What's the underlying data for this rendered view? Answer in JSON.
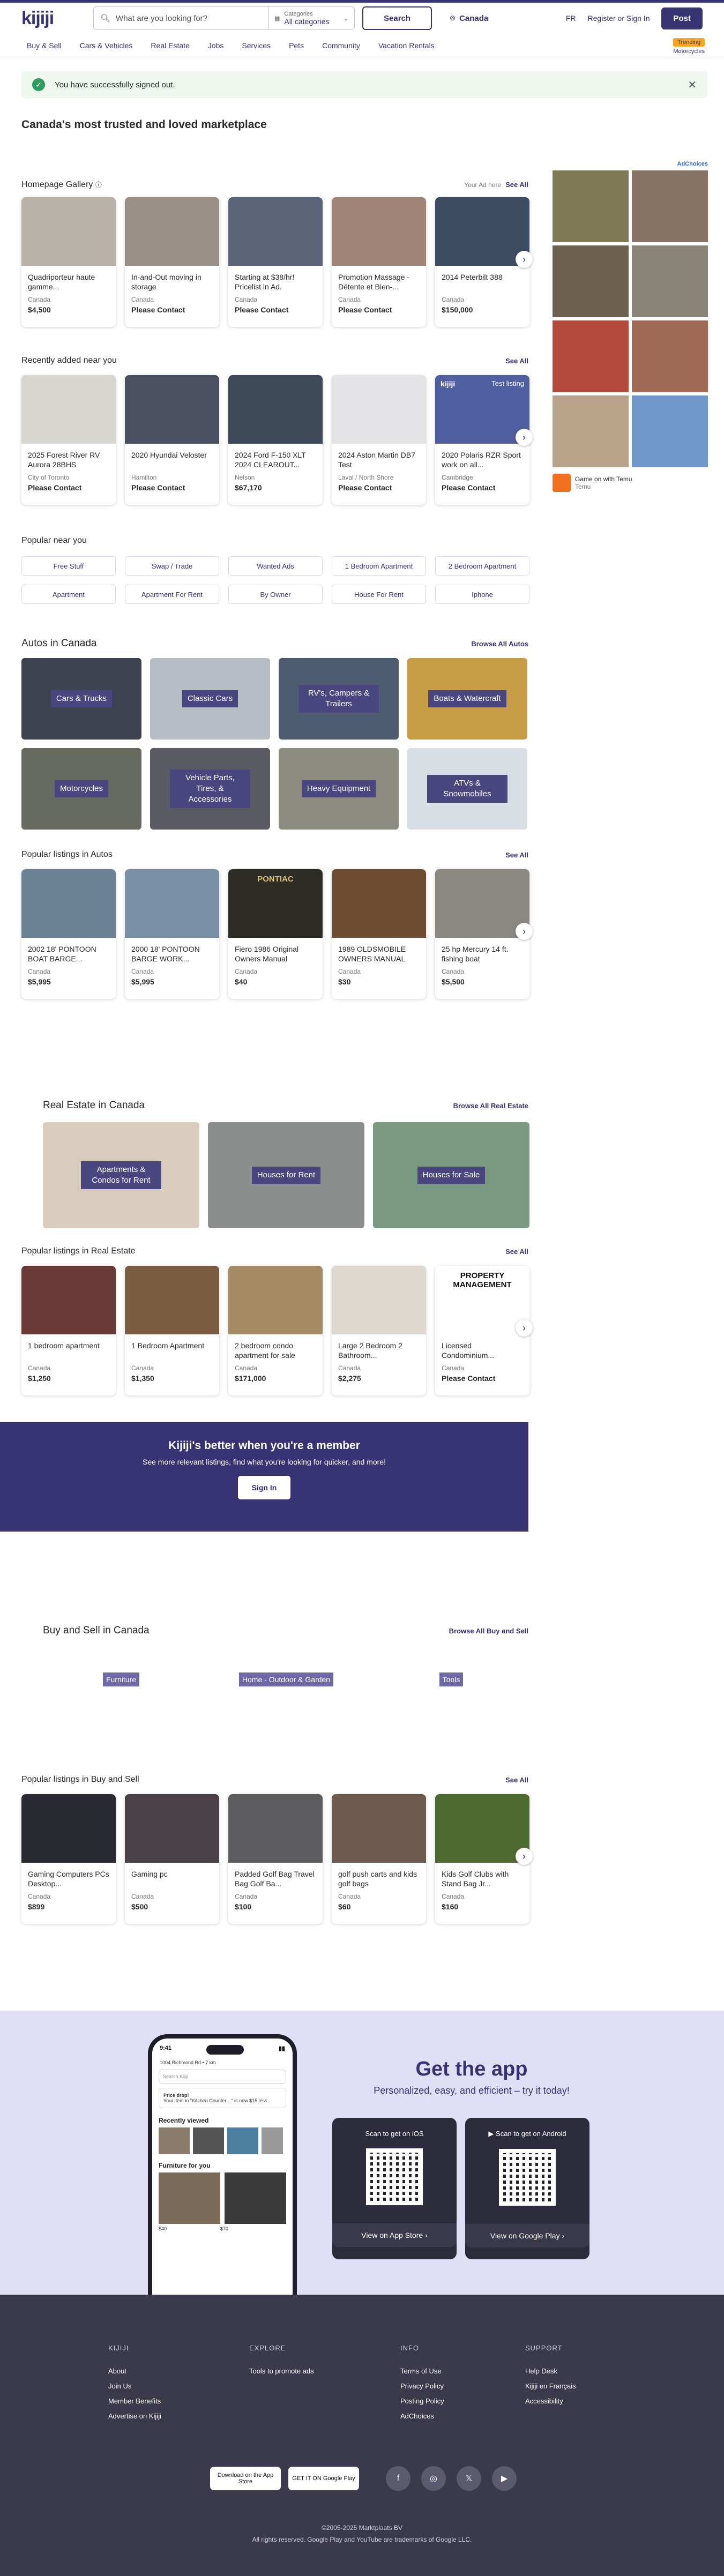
{
  "header": {
    "logo": "kijiji",
    "search_placeholder": "What are you looking for?",
    "categories_label": "Categories",
    "categories_value": "All categories",
    "search_button": "Search",
    "location": "Canada",
    "lang": "FR",
    "register": "Register or Sign In",
    "post": "Post"
  },
  "nav": {
    "items": [
      "Buy & Sell",
      "Cars & Vehicles",
      "Real Estate",
      "Jobs",
      "Services",
      "Pets",
      "Community",
      "Vacation Rentals"
    ],
    "trending_badge": "Trending",
    "trending_label": "Motorcycles"
  },
  "alert": {
    "text": "You have successfully signed out."
  },
  "page_title": "Canada's most trusted and loved marketplace",
  "gallery": {
    "title": "Homepage Gallery",
    "your_ad": "Your Ad here",
    "see_all": "See All",
    "items": [
      {
        "title": "Quadriporteur haute gamme...",
        "loc": "Canada",
        "price": "$4,500",
        "color": "#b8b2a8"
      },
      {
        "title": "In-and-Out moving in storage",
        "loc": "Canada",
        "price": "Please Contact",
        "color": "#9a8f86"
      },
      {
        "title": "Starting at $38/hr! Pricelist in Ad.",
        "loc": "Canada",
        "price": "Please Contact",
        "color": "#5b6478"
      },
      {
        "title": "Promotion Massage - Détente et Bien-...",
        "loc": "Canada",
        "price": "Please Contact",
        "color": "#a08476"
      },
      {
        "title": "2014 Peterbilt 388",
        "loc": "Canada",
        "price": "$150,000",
        "color": "#3c4c63"
      }
    ]
  },
  "recent": {
    "title": "Recently added near you",
    "see_all": "See All",
    "items": [
      {
        "title": "2025 Forest River RV Aurora 28BHS",
        "loc": "City of Toronto",
        "price": "Please Contact",
        "color": "#d7d5d0"
      },
      {
        "title": "2020 Hyundai Veloster",
        "loc": "Hamilton",
        "price": "Please Contact",
        "color": "#4b5060"
      },
      {
        "title": "2024 Ford F-150 XLT 2024 CLEAROUT...",
        "loc": "Nelson",
        "price": "$67,170",
        "color": "#3e4a5a"
      },
      {
        "title": "2024 Aston Martin DB7 Test",
        "loc": "Laval / North Shore",
        "price": "Please Contact",
        "color": "#e3e3e6"
      },
      {
        "title": "2020 Polaris RZR Sport work on all...",
        "loc": "Cambridge",
        "price": "Please Contact",
        "color": "#4f5fa0",
        "tag": "Test listing",
        "brand": "kijiji"
      }
    ]
  },
  "ad": {
    "choices": "AdChoices",
    "brand": "Game on with Temu",
    "sub": "Temu",
    "tiles": [
      "#7d7a55",
      "#887365",
      "#6d6150",
      "#8a8478",
      "#b34a3c",
      "#a16a57",
      "#b9a28a",
      "#6f97c9"
    ]
  },
  "popular": {
    "title": "Popular near you",
    "items": [
      "Free Stuff",
      "Swap / Trade",
      "Wanted Ads",
      "1 Bedroom Apartment",
      "2 Bedroom Apartment",
      "Apartment",
      "Apartment For Rent",
      "By Owner",
      "House For Rent",
      "Iphone"
    ]
  },
  "autos": {
    "title": "Autos in Canada",
    "link": "Browse All Autos",
    "tiles": [
      {
        "label": "Cars & Trucks",
        "color": "#3d4150"
      },
      {
        "label": "Classic Cars",
        "color": "#b8bcc4"
      },
      {
        "label": "RV's, Campers & Trailers",
        "color": "#4e5c72"
      },
      {
        "label": "Boats & Watercraft",
        "color": "#c89b46"
      },
      {
        "label": "Motorcycles",
        "color": "#666a60"
      },
      {
        "label": "Vehicle Parts, Tires, & Accessories",
        "color": "#5a5b63"
      },
      {
        "label": "Heavy Equipment",
        "color": "#8c8b80"
      },
      {
        "label": "ATVs & Snowmobiles",
        "color": "#d9dde4"
      }
    ]
  },
  "autos_listings": {
    "title": "Popular listings in Autos",
    "see_all": "See All",
    "items": [
      {
        "title": "2002 18' PONTOON BOAT BARGE...",
        "loc": "Canada",
        "price": "$5,995",
        "color": "#6b8196"
      },
      {
        "title": "2000 18' PONTOON BARGE WORK...",
        "loc": "Canada",
        "price": "$5,995",
        "color": "#7990a6"
      },
      {
        "title": "Fiero 1986 Original Owners Manual",
        "loc": "Canada",
        "price": "$40",
        "color": "#2e2c27",
        "label": "PONTIAC"
      },
      {
        "title": "1989 OLDSMOBILE OWNERS MANUAL",
        "loc": "Canada",
        "price": "$30",
        "color": "#6c4d33"
      },
      {
        "title": "25 hp Mercury 14 ft. fishing boat",
        "loc": "Canada",
        "price": "$5,500",
        "color": "#8a8880"
      }
    ]
  },
  "realestate": {
    "title": "Real Estate in Canada",
    "link": "Browse All Real Estate",
    "tiles": [
      {
        "label": "Apartments & Condos for Rent",
        "color": "#d8cdbd"
      },
      {
        "label": "Houses for Rent",
        "color": "#8c8d8d"
      },
      {
        "label": "Houses for Sale",
        "color": "#7b9a82"
      }
    ]
  },
  "re_listings": {
    "title": "Popular listings in Real Estate",
    "see_all": "See All",
    "items": [
      {
        "title": "1 bedroom apartment",
        "loc": "Canada",
        "price": "$1,250",
        "color": "#6a3a36"
      },
      {
        "title": "1 Bedroom Apartment",
        "loc": "Canada",
        "price": "$1,350",
        "color": "#7a5c43"
      },
      {
        "title": "2 bedroom condo apartment for sale",
        "loc": "Canada",
        "price": "$171,000",
        "color": "#a58b64"
      },
      {
        "title": "Large 2 Bedroom 2 Bathroom...",
        "loc": "Canada",
        "price": "$2,275",
        "color": "#ddd8d0"
      },
      {
        "title": "Licensed Condominium...",
        "loc": "Canada",
        "price": "Please Contact",
        "color": "#ffffff",
        "label": "PROPERTY MANAGEMENT"
      }
    ]
  },
  "member": {
    "title": "Kijiji's better when you're a member",
    "text": "See more relevant listings, find what you're looking for quicker, and more!",
    "button": "Sign In"
  },
  "buysell": {
    "title": "Buy and Sell in Canada",
    "link": "Browse All Buy and Sell",
    "tiles": [
      "Furniture",
      "Home - Outdoor & Garden",
      "Tools"
    ]
  },
  "bs_listings": {
    "title": "Popular listings in Buy and Sell",
    "see_all": "See All",
    "items": [
      {
        "title": "Gaming Computers PCs Desktop...",
        "loc": "Canada",
        "price": "$899",
        "color": "#2a2a33"
      },
      {
        "title": "Gaming pc",
        "loc": "Canada",
        "price": "$500",
        "color": "#4a4048"
      },
      {
        "title": "Padded Golf Bag Travel Bag Golf Ba...",
        "loc": "Canada",
        "price": "$100",
        "color": "#5d5d5f"
      },
      {
        "title": "golf push carts and kids golf bags",
        "loc": "Canada",
        "price": "$60",
        "color": "#6d5a4c"
      },
      {
        "title": "Kids Golf Clubs with Stand Bag Jr...",
        "loc": "Canada",
        "price": "$160",
        "color": "#4f6b32"
      }
    ]
  },
  "app": {
    "title": "Get the app",
    "subtitle": "Personalized, easy, and efficient – try it today!",
    "ios_head": "Scan to get on iOS",
    "android_head": "Scan to get on Android",
    "ios_btn": "View on App Store",
    "android_btn": "View on Google Play",
    "phone": {
      "time": "9:41",
      "address": "1004 Richmond Rd • 7 km",
      "search": "Search Kijiji",
      "promo_title": "Price drop!",
      "promo_text": "Your item in \"Kitchen Counter…\" is now $15 less.",
      "recent": "Recently viewed",
      "furniture": "Furniture for you",
      "p1": "$40",
      "p2": "$70"
    }
  },
  "footer": {
    "cols": [
      {
        "head": "KIJIJI",
        "links": [
          "About",
          "Join Us",
          "Member Benefits",
          "Advertise on Kijiji"
        ]
      },
      {
        "head": "EXPLORE",
        "links": [
          "Tools to promote ads"
        ]
      },
      {
        "head": "INFO",
        "links": [
          "Terms of Use",
          "Privacy Policy",
          "Posting Policy",
          "AdChoices"
        ]
      },
      {
        "head": "SUPPORT",
        "links": [
          "Help Desk",
          "Kijiji en Français",
          "Accessibility"
        ]
      }
    ],
    "appstore": "Download on the App Store",
    "googleplay": "GET IT ON Google Play",
    "copy1": "©2005-2025 Marktplaats BV",
    "copy2": "All rights reserved. Google Play and YouTube are trademarks of Google LLC."
  }
}
